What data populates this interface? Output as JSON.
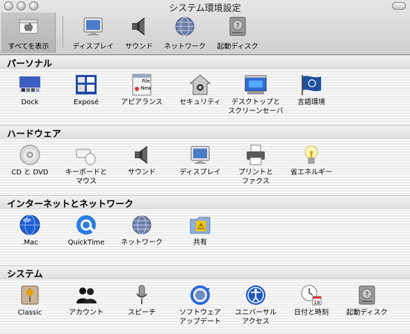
{
  "window": {
    "title": "システム環境設定"
  },
  "toolbar": {
    "show_all": "すべてを表示",
    "items": [
      "ディスプレイ",
      "サウンド",
      "ネットワーク",
      "起動ディスク"
    ]
  },
  "sections": [
    {
      "title": "パーソナル",
      "items": [
        "Dock",
        "Exposé",
        "アピアランス",
        "セキュリティ",
        "デスクトップと\nスクリーンセーバ",
        "言語環境"
      ]
    },
    {
      "title": "ハードウェア",
      "items": [
        "CD と DVD",
        "キーボードと\nマウス",
        "サウンド",
        "ディスプレイ",
        "プリントと\nファクス",
        "省エネルギー"
      ]
    },
    {
      "title": "インターネットとネットワーク",
      "items": [
        ".Mac",
        "QuickTime",
        "ネットワーク",
        "共有"
      ]
    },
    {
      "title": "システム",
      "items": [
        "Classic",
        "アカウント",
        "スピーチ",
        "ソフトウェア\nアップデート",
        "ユニバーサル\nアクセス",
        "日付と時刻",
        "起動ディスク"
      ]
    }
  ],
  "icons": {
    "toolbar": [
      "apple-icon",
      "display-icon",
      "speaker-icon",
      "network-globe-icon",
      "harddisk-icon"
    ],
    "personal": [
      "dock-icon",
      "expose-icon",
      "appearance-icon",
      "security-house-icon",
      "desktop-icon",
      "un-flag-icon"
    ],
    "hardware": [
      "cd-disc-icon",
      "keyboard-mouse-icon",
      "speaker-icon",
      "display-icon",
      "printer-icon",
      "lightbulb-icon"
    ],
    "internet": [
      "dotmac-globe-icon",
      "quicktime-icon",
      "network-globe-icon",
      "sharing-folder-icon"
    ],
    "system": [
      "classic-icon",
      "accounts-silhouette-icon",
      "microphone-icon",
      "software-update-icon",
      "universal-access-icon",
      "clock-calendar-icon",
      "harddisk-icon"
    ]
  },
  "colors": {
    "accent": "#1a4fb0",
    "section_header": "#e3e3e3"
  }
}
